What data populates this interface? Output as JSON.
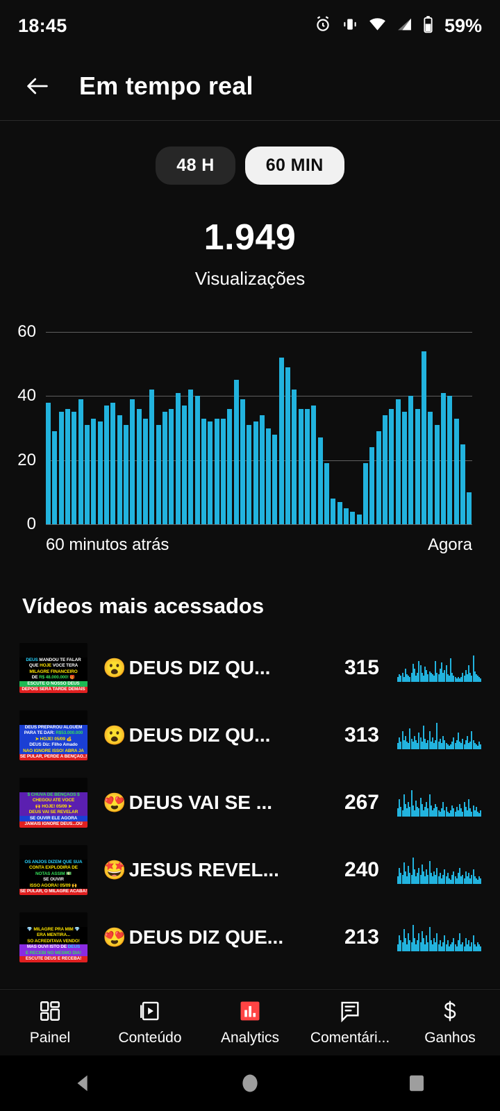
{
  "status_bar": {
    "time": "18:45",
    "battery_percent": "59%",
    "icons": [
      "alarm-icon",
      "vibrate-icon",
      "wifi-icon",
      "signal-icon",
      "battery-icon"
    ]
  },
  "app_bar": {
    "back_icon": "back-arrow-icon",
    "title": "Em tempo real"
  },
  "range_toggle": {
    "options": [
      {
        "label": "48 H",
        "selected": false
      },
      {
        "label": "60 MIN",
        "selected": true
      }
    ]
  },
  "metric": {
    "value": "1.949",
    "label": "Visualizações"
  },
  "chart_data": {
    "type": "bar",
    "title": "",
    "xlabel": "",
    "ylabel": "",
    "x_axis_start_label": "60 minutos atrás",
    "x_axis_end_label": "Agora",
    "ylim": [
      0,
      65
    ],
    "yticks": [
      0,
      20,
      40,
      60
    ],
    "ytick_labels": [
      "0",
      "20",
      "40",
      "60"
    ],
    "grid": true,
    "bar_color": "#22b3de",
    "categories": [
      "t-60",
      "t-59",
      "t-58",
      "t-57",
      "t-56",
      "t-55",
      "t-54",
      "t-53",
      "t-52",
      "t-51",
      "t-50",
      "t-49",
      "t-48",
      "t-47",
      "t-46",
      "t-45",
      "t-44",
      "t-43",
      "t-42",
      "t-41",
      "t-40",
      "t-39",
      "t-38",
      "t-37",
      "t-36",
      "t-35",
      "t-34",
      "t-33",
      "t-32",
      "t-31",
      "t-30",
      "t-29",
      "t-28",
      "t-27",
      "t-26",
      "t-25",
      "t-24",
      "t-23",
      "t-22",
      "t-21",
      "t-20",
      "t-19",
      "t-18",
      "t-17",
      "t-16",
      "t-15",
      "t-14",
      "t-13",
      "t-12",
      "t-11",
      "t-10",
      "t-9",
      "t-8",
      "t-7",
      "t-6",
      "t-5",
      "t-4",
      "t-3",
      "t-2",
      "t-1"
    ],
    "values": [
      38,
      29,
      35,
      36,
      35,
      39,
      31,
      33,
      32,
      37,
      38,
      34,
      31,
      39,
      36,
      33,
      42,
      31,
      35,
      36,
      41,
      37,
      42,
      40,
      33,
      32,
      33,
      33,
      36,
      45,
      39,
      31,
      32,
      34,
      30,
      28,
      52,
      49,
      42,
      36,
      36,
      37,
      27,
      19,
      8,
      7,
      5,
      4,
      3,
      19,
      24,
      29,
      34,
      36,
      39,
      35,
      40,
      36,
      54,
      35,
      31,
      41,
      40,
      33,
      25,
      10
    ]
  },
  "videos_section": {
    "title": "Vídeos mais acessados",
    "items": [
      {
        "emoji": "😮",
        "title": "DEUS DIZ QU...",
        "views": "315",
        "thumbnail": {
          "background": "#050505",
          "lines": [
            {
              "text": "DEUS MANDOU TE FALAR",
              "color": "#ffffff",
              "highlight_text": "DEUS",
              "highlight_color": "#2ad4ff",
              "bg": "#000000"
            },
            {
              "text": "QUE HOJE VOCÊ TERÁ",
              "color": "#ffffff",
              "highlight_text": "HOJE",
              "highlight_color": "#ffe600",
              "bg": "#000000"
            },
            {
              "text": "MILAGRE FINANCEIRO",
              "color": "#ffe600",
              "bg": "#000000"
            },
            {
              "text": "DE R$ 48.000.000! 🎁",
              "color": "#ffffff",
              "highlight_text": "R$ 48.000.000!",
              "highlight_color": "#35e05a",
              "bg": "#000000"
            },
            {
              "text": "ESCUTE O NOSSO DEUS",
              "color": "#ffffff",
              "bg": "#1db954"
            },
            {
              "text": "DEPOIS SERÁ TARDE DEMAIS",
              "color": "#ffffff",
              "bg": "#e02020"
            }
          ],
          "sparkline": [
            3,
            5,
            4,
            6,
            3,
            9,
            5,
            4,
            3,
            6,
            12,
            9,
            4,
            6,
            14,
            11,
            6,
            4,
            10,
            8,
            5,
            7,
            6,
            5,
            4,
            14,
            6,
            5,
            9,
            13,
            6,
            8,
            11,
            5,
            4,
            16,
            6,
            4,
            3,
            2,
            3,
            2,
            3,
            6,
            4,
            8,
            5,
            11,
            6,
            4,
            18,
            7,
            5,
            4,
            3,
            2
          ]
        }
      },
      {
        "emoji": "😮",
        "title": "DEUS DIZ QU...",
        "views": "313",
        "thumbnail": {
          "background": "#050505",
          "lines": [
            {
              "text": "DEUS PREPAROU ALGUÉM",
              "color": "#ffffff",
              "bg": "#1a3fd4"
            },
            {
              "text": "PARA TE DAR: R$53.000.000",
              "color": "#ffffff",
              "highlight_text": "R$53.000.000",
              "highlight_color": "#35e05a",
              "bg": "#1a3fd4"
            },
            {
              "text": "➤ HOJE! 05/09 💰",
              "color": "#ffe600",
              "bg": "#1a3fd4"
            },
            {
              "text": "DEUS Diz: Filho Amado",
              "color": "#ffffff",
              "bg": "#1a3fd4"
            },
            {
              "text": "NÃO IGNORE ISSO! ABRA JÁ",
              "color": "#ffe600",
              "bg": "#1a3fd4"
            },
            {
              "text": "SE PULAR, PERDE A BENÇÃO..!",
              "color": "#ffffff",
              "bg": "#e02020"
            }
          ],
          "sparkline": [
            4,
            8,
            5,
            12,
            6,
            9,
            5,
            4,
            14,
            7,
            5,
            9,
            6,
            4,
            11,
            8,
            5,
            16,
            7,
            4,
            6,
            12,
            5,
            8,
            4,
            6,
            18,
            5,
            7,
            4,
            9,
            6,
            4,
            3,
            2,
            3,
            5,
            8,
            4,
            6,
            11,
            5,
            4,
            7,
            3,
            6,
            9,
            4,
            5,
            12,
            6,
            4,
            3,
            2,
            5,
            3
          ]
        }
      },
      {
        "emoji": "😍",
        "title": "DEUS VAI SE ...",
        "views": "267",
        "thumbnail": {
          "background": "#050505",
          "lines": [
            {
              "text": "$ CHUVA DE BÊNÇÃOS $",
              "color": "#35e05a",
              "bg": "#5b1fb0"
            },
            {
              "text": "CHEGOU ATÉ VOCÊ",
              "color": "#ffe600",
              "bg": "#5b1fb0"
            },
            {
              "text": "🙌 HOJE! 05/09 ➤",
              "color": "#ffe600",
              "bg": "#5b1fb0"
            },
            {
              "text": "DEUS VAI SE REVELAR",
              "color": "#ffe600",
              "bg": "#5b1fb0"
            },
            {
              "text": "SE OUVIR ELE AGORA",
              "color": "#ffffff",
              "bg": "#1a3fd4"
            },
            {
              "text": "JAMAIS IGNORE DEUS...OU",
              "color": "#ffffff",
              "bg": "#e02020"
            }
          ],
          "sparkline": [
            5,
            11,
            6,
            4,
            14,
            8,
            5,
            9,
            6,
            17,
            7,
            4,
            10,
            6,
            5,
            12,
            8,
            4,
            6,
            9,
            5,
            14,
            7,
            4,
            5,
            8,
            6,
            4,
            3,
            5,
            9,
            4,
            6,
            3,
            2,
            4,
            7,
            5,
            3,
            6,
            4,
            8,
            5,
            3,
            9,
            6,
            4,
            11,
            5,
            3,
            7,
            4,
            6,
            3,
            2,
            4
          ]
        }
      },
      {
        "emoji": "🤩",
        "title": "JESUS REVEL...",
        "views": "240",
        "thumbnail": {
          "background": "#050505",
          "lines": [
            {
              "text": "OS ANJOS DIZEM QUE SUA",
              "color": "#2ad4ff",
              "bg": "#000000"
            },
            {
              "text": "CONTA EXPLODIRÁ DE",
              "color": "#ffe600",
              "bg": "#000000"
            },
            {
              "text": "NOTAS ASSIM 💵",
              "color": "#35e05a",
              "bg": "#000000"
            },
            {
              "text": "SE OUVIR",
              "color": "#ffffff",
              "bg": "#000000"
            },
            {
              "text": "ISSO AGORA! 05/09 🙌",
              "color": "#ffe600",
              "bg": "#000000"
            },
            {
              "text": "SE PULAR, O MILAGRE ACABA!",
              "color": "#ffffff",
              "bg": "#e02020"
            }
          ],
          "sparkline": [
            4,
            9,
            6,
            5,
            12,
            7,
            4,
            10,
            6,
            5,
            15,
            8,
            4,
            6,
            9,
            5,
            11,
            7,
            4,
            8,
            5,
            13,
            6,
            4,
            7,
            5,
            9,
            4,
            6,
            3,
            5,
            8,
            4,
            6,
            3,
            2,
            5,
            7,
            4,
            3,
            6,
            9,
            4,
            5,
            3,
            7,
            4,
            6,
            3,
            5,
            8,
            4,
            3,
            2,
            4,
            3
          ]
        }
      },
      {
        "emoji": "😍",
        "title": "DEUS DIZ QUE...",
        "views": "213",
        "thumbnail": {
          "background": "#050505",
          "lines": [
            {
              "text": "💎 MILAGRE PRA MIM 💎",
              "color": "#ffe600",
              "bg": "#000000"
            },
            {
              "text": "ERA MENTIRA...",
              "color": "#ffe600",
              "bg": "#000000"
            },
            {
              "text": "SÓ ACREDITAVA VENDO!",
              "color": "#ffe600",
              "bg": "#000000"
            },
            {
              "text": "MAS OUVI ISTO DE DEUS",
              "color": "#ffffff",
              "highlight_text": "DEUS",
              "highlight_color": "#2ad4ff",
              "bg": "#8a2be2"
            },
            {
              "text": "E RECEBI NO MESMO DIA!",
              "color": "#35e05a",
              "bg": "#8a2be2"
            },
            {
              "text": "ESCUTE DEUS E RECEBA!",
              "color": "#ffffff",
              "bg": "#e02020"
            }
          ],
          "sparkline": [
            3,
            7,
            5,
            4,
            10,
            6,
            3,
            8,
            5,
            4,
            12,
            6,
            3,
            5,
            8,
            4,
            9,
            6,
            3,
            7,
            4,
            11,
            5,
            3,
            6,
            4,
            8,
            3,
            5,
            2,
            4,
            7,
            3,
            5,
            2,
            3,
            4,
            6,
            3,
            2,
            5,
            8,
            3,
            4,
            2,
            6,
            3,
            5,
            2,
            4,
            7,
            3,
            2,
            4,
            3,
            2
          ]
        }
      }
    ]
  },
  "bottom_nav": {
    "items": [
      {
        "label": "Painel",
        "icon": "dashboard-icon",
        "active": false
      },
      {
        "label": "Conteúdo",
        "icon": "video-play-icon",
        "active": false
      },
      {
        "label": "Analytics",
        "icon": "analytics-bar-chart-icon",
        "active": true
      },
      {
        "label": "Comentári...",
        "icon": "comment-bubble-icon",
        "active": false
      },
      {
        "label": "Ganhos",
        "icon": "dollar-icon",
        "active": false
      }
    ],
    "active_color": "#ff4444"
  },
  "android_nav": {
    "buttons": [
      {
        "icon": "nav-back-triangle-icon"
      },
      {
        "icon": "nav-home-circle-icon"
      },
      {
        "icon": "nav-recents-square-icon"
      }
    ]
  }
}
